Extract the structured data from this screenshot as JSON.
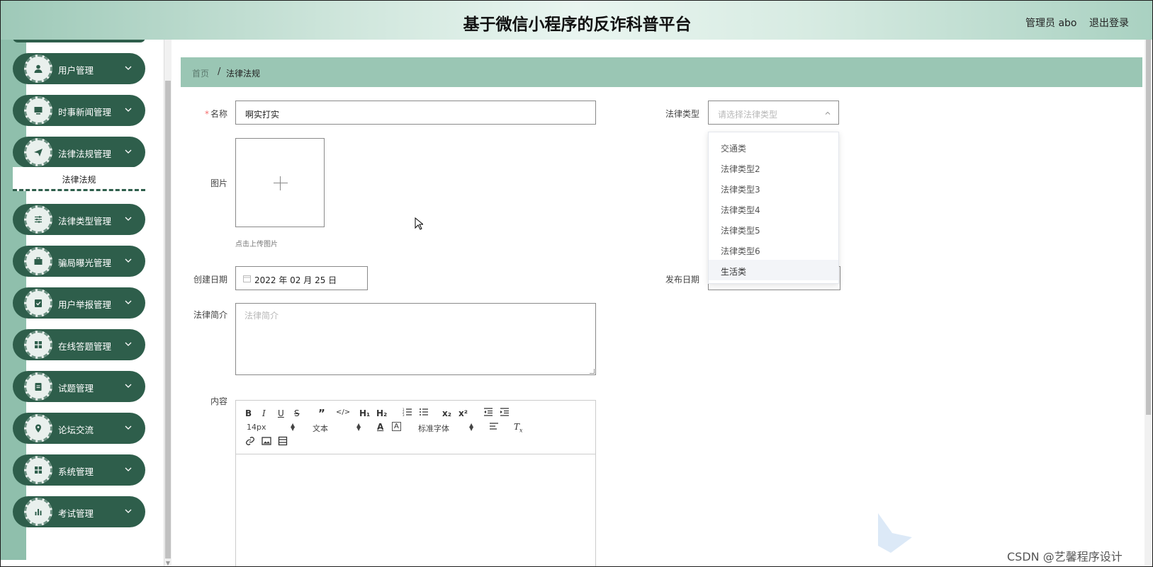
{
  "header": {
    "title": "基于微信小程序的反诈科普平台",
    "admin": "管理员 abo",
    "logout": "退出登录"
  },
  "sidebar": {
    "items": [
      {
        "label": "用户管理",
        "icon": "user-icon"
      },
      {
        "label": "时事新闻管理",
        "icon": "monitor-icon"
      },
      {
        "label": "法律法规管理",
        "icon": "send-icon",
        "sub": "法律法规"
      },
      {
        "label": "法律类型管理",
        "icon": "sliders-icon"
      },
      {
        "label": "骗局曝光管理",
        "icon": "briefcase-icon"
      },
      {
        "label": "用户举报管理",
        "icon": "clipboard-check-icon"
      },
      {
        "label": "在线答题管理",
        "icon": "grid-icon"
      },
      {
        "label": "试题管理",
        "icon": "clipboard-icon"
      },
      {
        "label": "论坛交流",
        "icon": "location-pin-icon"
      },
      {
        "label": "系统管理",
        "icon": "grid-icon"
      },
      {
        "label": "考试管理",
        "icon": "bar-chart-icon"
      }
    ]
  },
  "breadcrumb": {
    "home": "首页",
    "separator": "/",
    "current": "法律法规"
  },
  "form": {
    "name_label": "名称",
    "name_required": "*",
    "name_value": "啊实打实",
    "type_label": "法律类型",
    "type_placeholder": "请选择法律类型",
    "image_label": "图片",
    "upload_hint": "点击上传图片",
    "created_label": "创建日期",
    "created_value": "2022 年 02 月 25 日",
    "published_label": "发布日期",
    "intro_label": "法律简介",
    "intro_placeholder": "法律简介",
    "content_label": "内容"
  },
  "dropdown": {
    "options": [
      "交通类",
      "法律类型2",
      "法律类型3",
      "法律类型4",
      "法律类型5",
      "法律类型6",
      "生活类"
    ],
    "highlighted": "生活类"
  },
  "editor": {
    "font_size": "14px",
    "text_style": "文本",
    "font_family": "标准字体"
  },
  "watermark": "CSDN @艺馨程序设计"
}
